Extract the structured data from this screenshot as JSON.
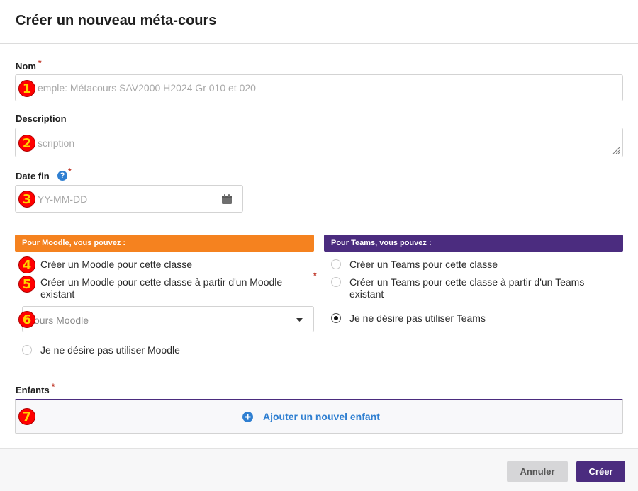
{
  "dialog": {
    "title": "Créer un nouveau méta-cours"
  },
  "form": {
    "name": {
      "label": "Nom",
      "required_mark": "*",
      "placeholder": "emple: Métacours SAV2000 H2024 Gr 010 et 020"
    },
    "description": {
      "label": "Description",
      "placeholder": "scription"
    },
    "end_date": {
      "label": "Date fin",
      "help_icon": "question-circle-icon",
      "required_mark": "*",
      "placeholder": "YY-MM-DD",
      "icon": "calendar-icon"
    },
    "moodle": {
      "heading": "Pour Moodle, vous pouvez :",
      "color": "#f5821f",
      "option_create": "Créer un Moodle pour cette classe",
      "option_from_existing": "Créer un Moodle pour cette classe à partir d'un Moodle existant",
      "option_from_existing_required": "*",
      "select_placeholder": "ours Moodle",
      "option_none": "Je ne désire pas utiliser Moodle"
    },
    "teams": {
      "heading": "Pour Teams, vous pouvez :",
      "color": "#4b2c7f",
      "option_create": "Créer un Teams pour cette classe",
      "option_from_existing": "Créer un Teams pour cette classe à partir d'un Teams existant",
      "option_none": "Je ne désire pas utiliser Teams",
      "selected": "option_none"
    },
    "children": {
      "label": "Enfants",
      "required_mark": "*",
      "add_label": "Ajouter un nouvel enfant",
      "add_icon": "plus-circle-icon"
    }
  },
  "markers": [
    "1",
    "2",
    "3",
    "4",
    "5",
    "6",
    "7"
  ],
  "footer": {
    "cancel_label": "Annuler",
    "create_label": "Créer"
  },
  "colors": {
    "accent_purple": "#4b2c7f",
    "moodle_orange": "#f5821f",
    "link_blue": "#2f7fd1",
    "marker_red": "#ff0000",
    "marker_yellow": "#ffd400"
  }
}
